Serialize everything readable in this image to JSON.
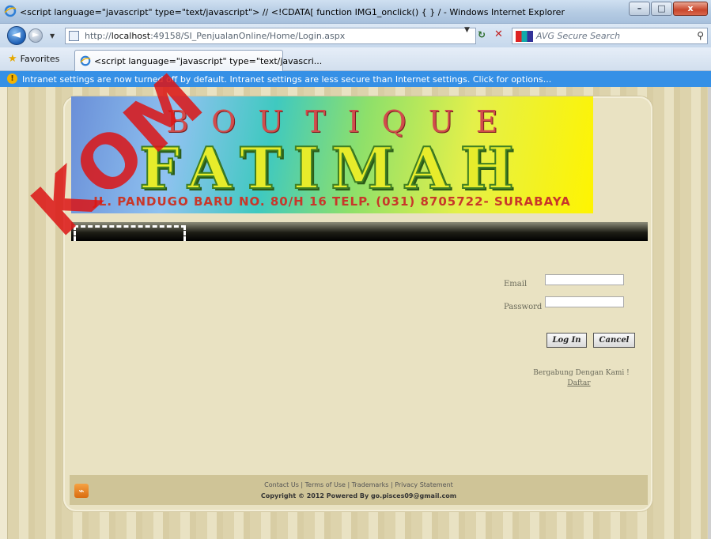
{
  "window": {
    "title": "<script language=\"javascript\" type=\"text/javascript\"> // <!CDATA[ function IMG1_onclick() { } / - Windows Internet Explorer",
    "minimize": "–",
    "maximize": "□",
    "close": "x"
  },
  "address": {
    "url_prefix": "http://",
    "url_host": "localhost",
    "url_rest": ":49158/SI_PenjualanOnline/Home/Login.aspx",
    "search_placeholder": "AVG Secure Search"
  },
  "favorites": {
    "label": "Favorites",
    "tab_label": "<script language=\"javascript\" type=\"text/javascri..."
  },
  "infobar": {
    "message": "Intranet settings are now turned off by default. Intranet settings are less secure than Internet settings. Click for options..."
  },
  "banner": {
    "line1": "BOUTIQUE",
    "line2": "FATIMAH",
    "line3": "JL. PANDUGO BARU NO. 80/H 16 TELP. (031) 8705722- SURABAYA"
  },
  "login": {
    "email_label": "Email",
    "email_value": "",
    "password_label": "Password",
    "password_value": "",
    "login_button": "Log In",
    "cancel_button": "Cancel",
    "join_text": "Bergabung Dengan Kami !",
    "register_link": "Daftar"
  },
  "footer": {
    "links": "Contact Us | Terms of Use | Trademarks | Privacy Statement",
    "copyright": "Copyright © 2012 Powered By go.pisces09@gmail.com"
  },
  "watermark": "KOM",
  "colors": {
    "infobar": "#3590e6",
    "titlebar": "#b5cbe3",
    "page_background": "#e9e2c2",
    "menu_bar": "#000000",
    "footer": "#cfc497",
    "watermark": "#dc1414"
  },
  "icons": [
    "ie-icon",
    "back-arrow-icon",
    "forward-arrow-icon",
    "page-icon",
    "refresh-icon",
    "stop-icon",
    "avg-icon",
    "search-icon",
    "favorites-star-icon",
    "warning-icon",
    "rss-icon"
  ]
}
